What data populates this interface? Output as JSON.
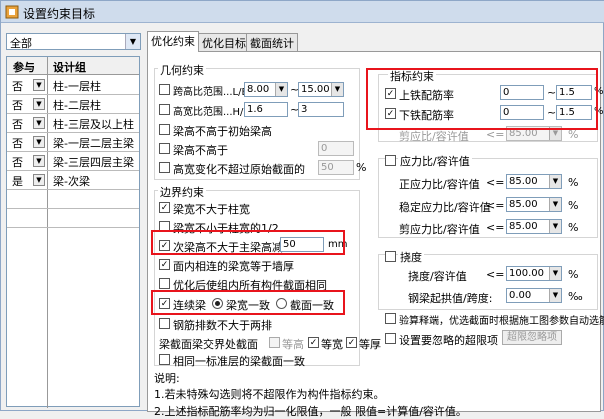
{
  "window": {
    "title": "设置约束目标"
  },
  "left": {
    "combo_value": "全部",
    "headers": [
      "参与",
      "设计组"
    ],
    "rows": [
      {
        "join": "否",
        "name": "柱-一层柱"
      },
      {
        "join": "否",
        "name": "柱-二层柱"
      },
      {
        "join": "否",
        "name": "柱-三层及以上柱"
      },
      {
        "join": "否",
        "name": "梁-一层二层主梁"
      },
      {
        "join": "否",
        "name": "梁-三层四层主梁"
      },
      {
        "join": "是",
        "name": "梁-次梁"
      }
    ]
  },
  "tabs": [
    "优化约束",
    "优化目标",
    "截面统计"
  ],
  "geom": {
    "title": "几何约束",
    "span_height": {
      "label": "跨高比范围...L/B",
      "min": "8.00",
      "tilde": "~",
      "max": "15.00"
    },
    "width_height": {
      "label": "高宽比范围...H/B",
      "min": "1.6",
      "tilde": "~",
      "max": "3"
    },
    "not_higher_initial": "梁高不高于初始梁高",
    "not_higher": {
      "label": "梁高不高于",
      "value": "0"
    },
    "height_change": {
      "label": "高宽变化不超过原始截面的",
      "value": "50",
      "unit": "%"
    }
  },
  "boundary": {
    "title": "边界约束",
    "items": [
      {
        "label": "梁宽不大于柱宽",
        "checked": true
      },
      {
        "label": "梁宽不小于柱宽的1/2",
        "checked": false
      },
      {
        "label": "次梁高不大于主梁高减",
        "checked": true,
        "value": "50",
        "unit": "mm"
      },
      {
        "label": "面内相连的梁宽等于墙厚",
        "checked": true
      },
      {
        "label": "优化后使组内所有构件截面相同",
        "checked": false
      },
      {
        "label": "连续梁",
        "checked": true,
        "radio1": "梁宽一致",
        "radio2": "截面一致"
      },
      {
        "label": "钢筋排数不大于两排",
        "checked": false
      }
    ],
    "cross": {
      "label": "梁截面梁交界处截面",
      "opt1": "等高",
      "opt2": "等宽",
      "opt3": "等厚"
    },
    "same_layer": "相同一标准层的梁截面一致"
  },
  "indicator": {
    "title": "指标约束",
    "top_rebar": {
      "label": "上铁配筋率",
      "min": "0",
      "tilde": "~",
      "max": "1.5",
      "unit": "%"
    },
    "bottom_rebar": {
      "label": "下铁配筋率",
      "min": "0",
      "tilde": "~",
      "max": "1.5",
      "unit": "%"
    },
    "shear_ratio_top": {
      "label": "剪应比/容许值",
      "op": "<=",
      "value": "85.00",
      "unit": "%"
    }
  },
  "stress": {
    "title": "应力比/容许值",
    "items": [
      {
        "label": "正应力比/容许值",
        "op": "<=",
        "value": "85.00",
        "unit": "%"
      },
      {
        "label": "稳定应力比/容许值",
        "op": "<=",
        "value": "85.00",
        "unit": "%"
      },
      {
        "label": "剪应力比/容许值",
        "op": "<=",
        "value": "85.00",
        "unit": "%"
      }
    ]
  },
  "deflection": {
    "title": "挠度",
    "items": [
      {
        "label": "挠度/容许值",
        "op": "<=",
        "value": "100.00",
        "unit": "%"
      },
      {
        "label": "钢梁起拱值/跨度:",
        "op": "",
        "value": "0.00",
        "unit": "‰"
      }
    ]
  },
  "calc_reinforce": "验算释端，优选截面时根据施工图参数自动选筋",
  "ignore_over": "设置要忽略的超限项",
  "ignore_btn": "超限忽略项",
  "notes": {
    "title": "说明:",
    "line1": "1.若未特殊勾选则将不超限作为构件指标约束。",
    "line2": "2.上述指标配筋率均为归一化限值，一般 限值=计算值/容许值。"
  }
}
